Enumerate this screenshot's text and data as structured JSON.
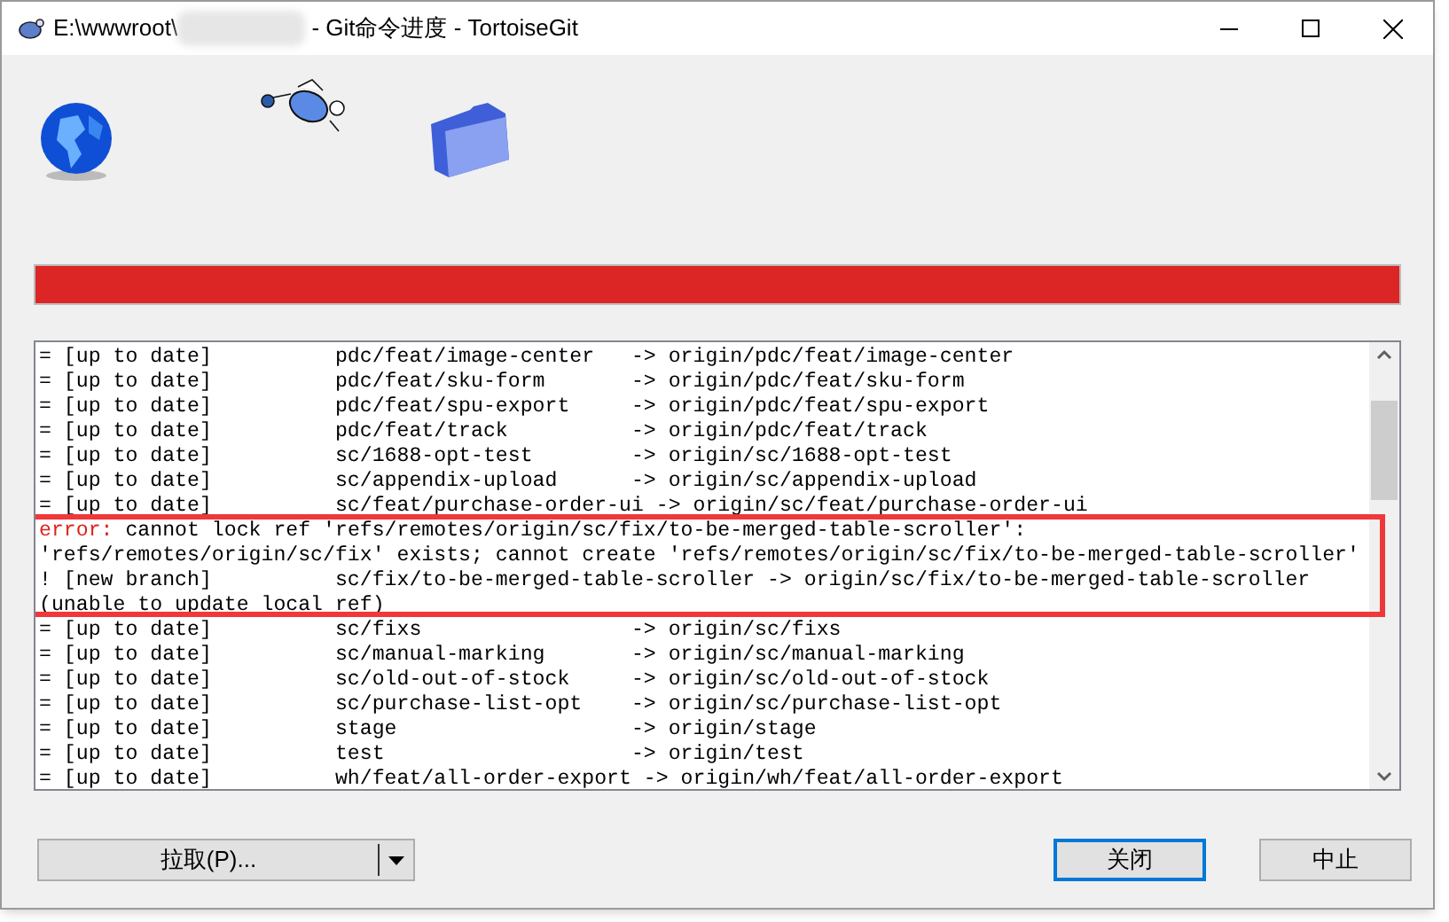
{
  "window": {
    "title_start": "E:\\wwwroot\\",
    "title_end": " - Git命令进度 - TortoiseGit"
  },
  "progress": {
    "level": 1,
    "error": true
  },
  "log": {
    "lines": [
      {
        "kind": "normal",
        "text": "= [up to date]          pdc/feat/image-center   -> origin/pdc/feat/image-center"
      },
      {
        "kind": "normal",
        "text": "= [up to date]          pdc/feat/sku-form       -> origin/pdc/feat/sku-form"
      },
      {
        "kind": "normal",
        "text": "= [up to date]          pdc/feat/spu-export     -> origin/pdc/feat/spu-export"
      },
      {
        "kind": "normal",
        "text": "= [up to date]          pdc/feat/track          -> origin/pdc/feat/track"
      },
      {
        "kind": "normal",
        "text": "= [up to date]          sc/1688-opt-test        -> origin/sc/1688-opt-test"
      },
      {
        "kind": "normal",
        "text": "= [up to date]          sc/appendix-upload      -> origin/sc/appendix-upload"
      },
      {
        "kind": "normal",
        "text": "= [up to date]          sc/feat/purchase-order-ui -> origin/sc/feat/purchase-order-ui"
      },
      {
        "kind": "error",
        "label": "error:",
        "text": " cannot lock ref 'refs/remotes/origin/sc/fix/to-be-merged-table-scroller':"
      },
      {
        "kind": "normal",
        "text": "'refs/remotes/origin/sc/fix' exists; cannot create 'refs/remotes/origin/sc/fix/to-be-merged-table-scroller'"
      },
      {
        "kind": "normal",
        "text": "! [new branch]          sc/fix/to-be-merged-table-scroller -> origin/sc/fix/to-be-merged-table-scroller"
      },
      {
        "kind": "normal",
        "text": "(unable to update local ref)"
      },
      {
        "kind": "normal",
        "text": "= [up to date]          sc/fixs                 -> origin/sc/fixs"
      },
      {
        "kind": "normal",
        "text": "= [up to date]          sc/manual-marking       -> origin/sc/manual-marking"
      },
      {
        "kind": "normal",
        "text": "= [up to date]          sc/old-out-of-stock     -> origin/sc/old-out-of-stock"
      },
      {
        "kind": "normal",
        "text": "= [up to date]          sc/purchase-list-opt    -> origin/sc/purchase-list-opt"
      },
      {
        "kind": "normal",
        "text": "= [up to date]          stage                   -> origin/stage"
      },
      {
        "kind": "normal",
        "text": "= [up to date]          test                    -> origin/test"
      },
      {
        "kind": "normal",
        "text": "= [up to date]          wh/feat/all-order-export -> origin/wh/feat/all-order-export"
      }
    ]
  },
  "buttons": {
    "pull": {
      "label": "拉取(P)..."
    },
    "close": {
      "label": "关闭",
      "default": true
    },
    "abort": {
      "label": "中止",
      "default": false
    }
  }
}
